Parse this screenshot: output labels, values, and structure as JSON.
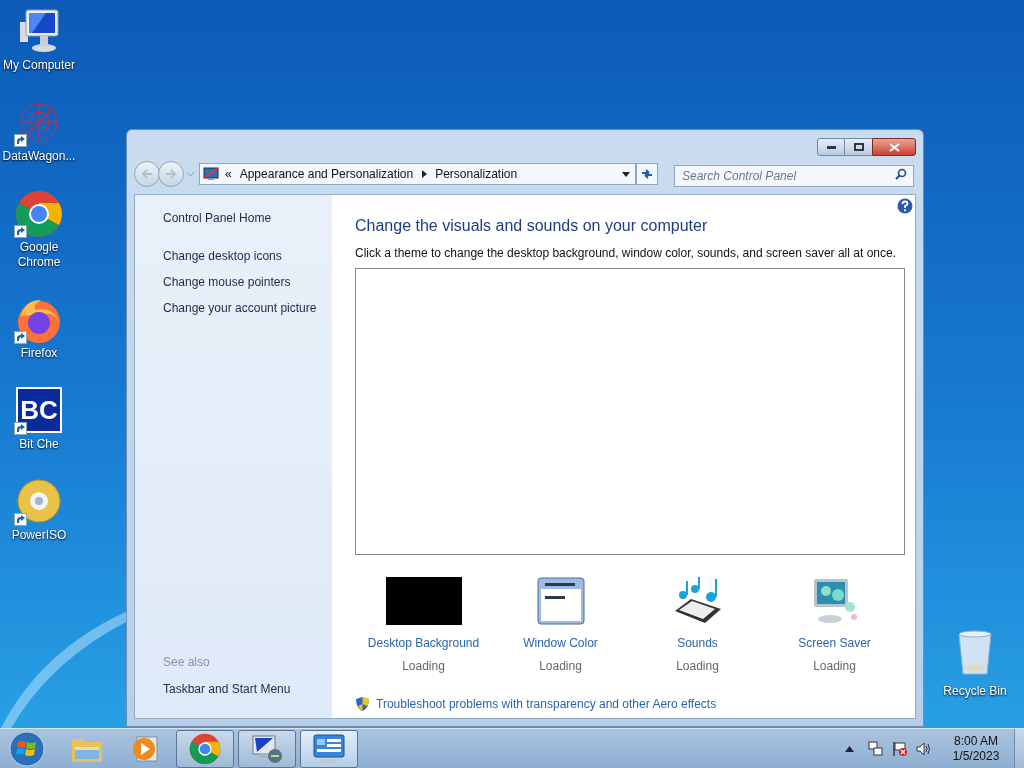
{
  "desktop_icons": [
    {
      "kind": "computer",
      "label": "My Computer",
      "shortcut": false
    },
    {
      "kind": "datawagon",
      "label": "DataWagon...",
      "shortcut": true
    },
    {
      "kind": "chrome",
      "label": "Google Chrome",
      "shortcut": true
    },
    {
      "kind": "firefox",
      "label": "Firefox",
      "shortcut": true
    },
    {
      "kind": "bc",
      "label": "Bit Che",
      "logo": "BC",
      "shortcut": true
    },
    {
      "kind": "disc",
      "label": "PowerISO",
      "shortcut": true
    }
  ],
  "recycle_bin": {
    "label": "Recycle Bin"
  },
  "window": {
    "navigation": {
      "back": {
        "disabled": true
      },
      "forward": {
        "disabled": true
      }
    },
    "address": {
      "overflow": "«",
      "crumbs": [
        "Appearance and Personalization",
        "Personalization"
      ]
    },
    "search": {
      "placeholder": "Search Control Panel"
    },
    "sidebar": {
      "home": "Control Panel Home",
      "links": [
        "Change desktop icons",
        "Change mouse pointers",
        "Change your account picture"
      ],
      "see_also_heading": "See also",
      "see_also": [
        "Taskbar and Start Menu"
      ]
    },
    "main": {
      "heading": "Change the visuals and sounds on your computer",
      "description": "Click a theme to change the desktop background, window color, sounds, and screen saver all at once.",
      "settings": [
        {
          "kind": "background",
          "label": "Desktop Background",
          "status": "Loading"
        },
        {
          "kind": "color",
          "label": "Window Color",
          "status": "Loading"
        },
        {
          "kind": "sounds",
          "label": "Sounds",
          "status": "Loading"
        },
        {
          "kind": "saver",
          "label": "Screen Saver",
          "status": "Loading"
        }
      ],
      "troubleshoot": "Troubleshoot problems with transparency and other Aero effects"
    }
  },
  "taskbar": {
    "items": [
      {
        "kind": "explorer",
        "running": false,
        "selected": false
      },
      {
        "kind": "media",
        "running": false,
        "selected": false
      },
      {
        "kind": "chrome",
        "running": true,
        "selected": false
      },
      {
        "kind": "remote",
        "running": true,
        "selected": false
      },
      {
        "kind": "control",
        "running": true,
        "selected": true
      }
    ],
    "time": "8:00 AM",
    "date": "1/5/2023"
  }
}
